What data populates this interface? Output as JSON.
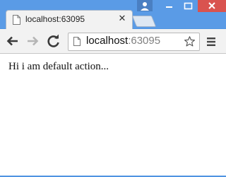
{
  "window": {
    "titlebar_color": "#5a9be6",
    "close_button_color": "#d9534f",
    "controls": [
      "profile-icon",
      "minimize-icon",
      "maximize-icon",
      "close-icon"
    ]
  },
  "tab": {
    "title": "localhost:63095",
    "close_glyph": "✕",
    "icon": "page-icon"
  },
  "toolbar": {
    "buttons": [
      "back-icon",
      "forward-icon",
      "reload-icon"
    ],
    "url_host": "localhost",
    "url_port": ":63095",
    "bookmark_icon": "star-icon",
    "menu_icon": "hamburger-menu-icon"
  },
  "page": {
    "text": "Hi i am default action..."
  }
}
